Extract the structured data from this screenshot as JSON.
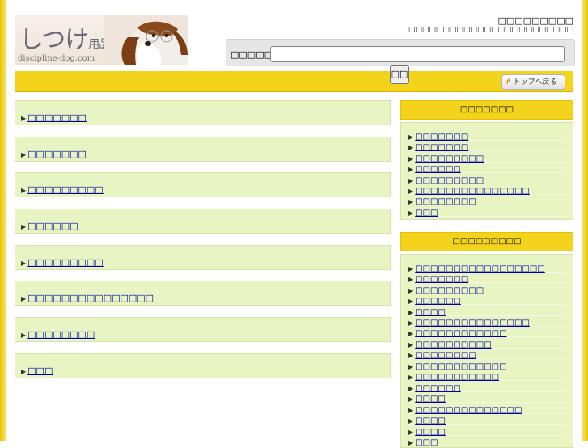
{
  "logo": {
    "text_jp": "しつけ",
    "text_jp_small": "用品",
    "text_en": "discipline-dog.com"
  },
  "header": {
    "title": "□□□□□□□□□",
    "subtitle": "□□□□□□□□□□□□□□□□□□□□□□□□"
  },
  "search": {
    "label": "□□□□□□□",
    "value": "",
    "button_label": "□□"
  },
  "top_link": {
    "label": "トップへ戻る"
  },
  "colors": {
    "accent": "#f4d31c",
    "list_bg": "#e8f4c2",
    "link": "#0000aa"
  },
  "main": {
    "items": [
      {
        "label": "□□□□□□□"
      },
      {
        "label": "□□□□□□□"
      },
      {
        "label": "□□□□□□□□□"
      },
      {
        "label": "□□□□□□"
      },
      {
        "label": "□□□□□□□□□"
      },
      {
        "label": "□□□□□□□□□□□□□□□"
      },
      {
        "label": "□□□□□□□□"
      },
      {
        "label": "□□□"
      }
    ]
  },
  "sidebar": {
    "section1": {
      "title": "□□□□□□□",
      "items": [
        {
          "label": "□□□□□□□"
        },
        {
          "label": "□□□□□□□"
        },
        {
          "label": "□□□□□□□□□"
        },
        {
          "label": "□□□□□□"
        },
        {
          "label": "□□□□□□□□□"
        },
        {
          "label": "□□□□□□□□□□□□□□□"
        },
        {
          "label": "□□□□□□□□"
        },
        {
          "label": "□□□"
        }
      ]
    },
    "section2": {
      "title": "□□□□□□□□□",
      "items": [
        {
          "label": "□□□□□□□□□□□□□□□□□"
        },
        {
          "label": "□□□□□□□"
        },
        {
          "label": "□□□□□□□□□"
        },
        {
          "label": "□□□□□□"
        },
        {
          "label": "□□□□"
        },
        {
          "label": "□□□□□□□□□□□□□□□"
        },
        {
          "label": "□□□□□□□□□□□□"
        },
        {
          "label": "□□□□□□□□□□"
        },
        {
          "label": "□□□□□□□□"
        },
        {
          "label": "□□□□□□□□□□□□"
        },
        {
          "label": "□□□□□□□□□□□"
        },
        {
          "label": "□□□□□□"
        },
        {
          "label": "□□□□"
        },
        {
          "label": "□□□□□□□□□□□□□□"
        },
        {
          "label": "□□□□"
        },
        {
          "label": "□□□□"
        },
        {
          "label": "□□□"
        }
      ]
    }
  }
}
